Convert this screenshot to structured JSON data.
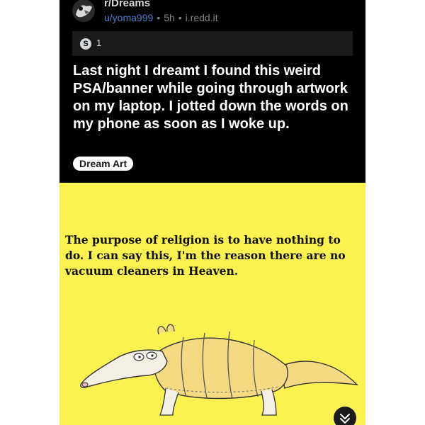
{
  "post": {
    "subreddit": "r/Dreams",
    "username": "u/yoma999",
    "age": "5h",
    "domain": "i.redd.it",
    "separator": "•",
    "awards": {
      "icon": "award-icon",
      "count": "1"
    },
    "title": "Last night I dreamt I found this weird PSA/banner while going through artwork on my laptop. I jotted down the words on my phone as soon as I woke up.",
    "flair": "Dream Art"
  },
  "image": {
    "quote": "The purpose of religion is to have nothing to do. I can say this, I'm the reason there are no vacuum cleaners in Heaven.",
    "background": "#fbf150"
  },
  "colors": {
    "header_bg": "#000000",
    "username": "#4f7fd0",
    "meta": "#818384",
    "title": "#ffffff"
  },
  "icons": [
    "subreddit-avatar-icon",
    "award-icon",
    "chevron-down-icon"
  ]
}
